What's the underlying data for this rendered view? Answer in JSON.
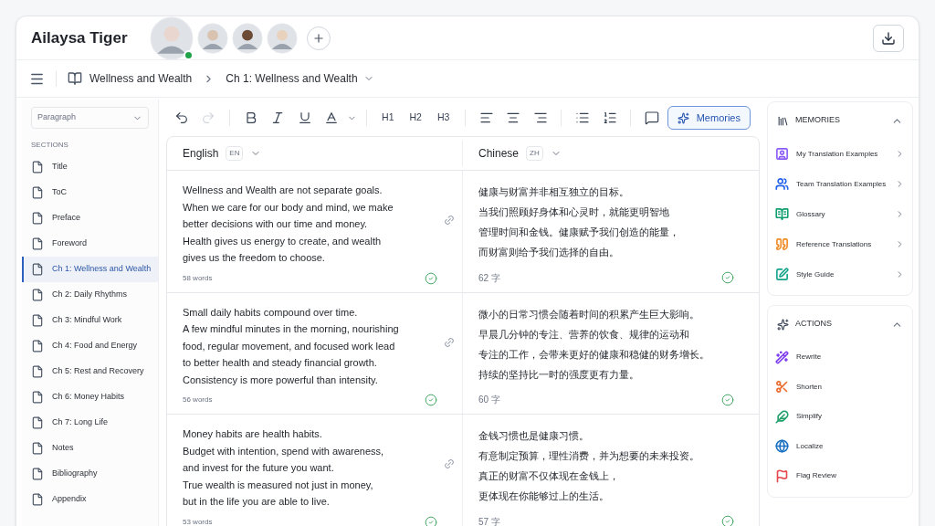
{
  "header": {
    "title": "Ailaysa Tiger",
    "collaborators": [
      {
        "online": true
      },
      {
        "online": false
      },
      {
        "online": false
      },
      {
        "online": false
      }
    ]
  },
  "breadcrumb": {
    "book": "Wellness and Wealth",
    "chapter": "Ch 1: Wellness and Wealth"
  },
  "sidebar": {
    "style_select": "Paragraph",
    "heading": "SECTIONS",
    "items": [
      {
        "label": "Title",
        "selected": false
      },
      {
        "label": "ToC",
        "selected": false
      },
      {
        "label": "Preface",
        "selected": false
      },
      {
        "label": "Foreword",
        "selected": false
      },
      {
        "label": "Ch 1: Wellness and Wealth",
        "selected": true
      },
      {
        "label": "Ch 2: Daily Rhythms",
        "selected": false
      },
      {
        "label": "Ch 3: Mindful Work",
        "selected": false
      },
      {
        "label": "Ch 4: Food and Energy",
        "selected": false
      },
      {
        "label": "Ch 5: Rest and Recovery",
        "selected": false
      },
      {
        "label": "Ch 6: Money Habits",
        "selected": false
      },
      {
        "label": "Ch 7: Long Life",
        "selected": false
      },
      {
        "label": "Notes",
        "selected": false
      },
      {
        "label": "Bibliography",
        "selected": false
      },
      {
        "label": "Appendix",
        "selected": false
      }
    ]
  },
  "toolbar": {
    "headings": [
      "H1",
      "H2",
      "H3"
    ],
    "memories_button": "Memories"
  },
  "editor": {
    "source": {
      "language": "English",
      "code": "EN"
    },
    "target": {
      "language": "Chinese",
      "code": "ZH"
    },
    "segments": [
      {
        "source": "Wellness and Wealth are not separate goals.\nWhen we care for our body and mind, we make\nbetter decisions with our time and money.\nHealth gives us energy to create, and wealth\ngives us the freedom to choose.",
        "source_count": "58 words",
        "target_lines": [
          "健康与财富并非相互独立的目标。",
          "当我们照顾好身体和心灵时，就能更明智地",
          "管理时间和金钱。健康赋予我们创造的能量，",
          "而财富则给予我们选择的自由。"
        ],
        "target_count": "62 字",
        "confirmed": true
      },
      {
        "source": "Small daily habits compound over time.\nA few mindful minutes in the morning, nourishing\nfood, regular movement, and focused work lead\nto better health and steady financial growth.\nConsistency is more powerful than intensity.",
        "source_count": "56 words",
        "target_lines": [
          "微小的日常习惯会随着时间的积累产生巨大影响。",
          "早晨几分钟的专注、营养的饮食、规律的运动和",
          "专注的工作，会带来更好的健康和稳健的财务增长。",
          "持续的坚持比一时的强度更有力量。"
        ],
        "target_count": "60 字",
        "confirmed": true
      },
      {
        "source": "Money habits are health habits.\nBudget with intention, spend with awareness,\nand invest for the future you want.\nTrue wealth is measured not just in money,\nbut in the life you are able to live.",
        "source_count": "53 words",
        "target_lines": [
          "金钱习惯也是健康习惯。",
          "有意制定预算，理性消费，并为想要的未来投资。",
          "真正的财富不仅体现在金钱上，",
          "更体现在你能够过上的生活。"
        ],
        "target_count": "57 字",
        "confirmed": true
      }
    ]
  },
  "memories": {
    "heading": "MEMORIES",
    "items": [
      {
        "kind": "examples",
        "label": "My Translation Examples",
        "color": "#8b5cf6"
      },
      {
        "kind": "team",
        "label": "Team Translation Examples",
        "color": "#2563eb"
      },
      {
        "kind": "glossary",
        "label": "Glossary",
        "color": "#0f9f6e"
      },
      {
        "kind": "reference",
        "label": "Reference Translations",
        "color": "#f08a24"
      },
      {
        "kind": "style",
        "label": "Style Guide",
        "color": "#14a38b"
      }
    ]
  },
  "actions": {
    "heading": "ACTIONS",
    "items": [
      {
        "kind": "rewrite",
        "label": "Rewrite",
        "color": "#7c3aed"
      },
      {
        "kind": "shorten",
        "label": "Shorten",
        "color": "#ea6a2a"
      },
      {
        "kind": "simplify",
        "label": "Simplify",
        "color": "#22a06b"
      },
      {
        "kind": "localize",
        "label": "Localize",
        "color": "#1d72c2"
      },
      {
        "kind": "flag",
        "label": "Flag Review",
        "color": "#e5484d"
      }
    ]
  }
}
